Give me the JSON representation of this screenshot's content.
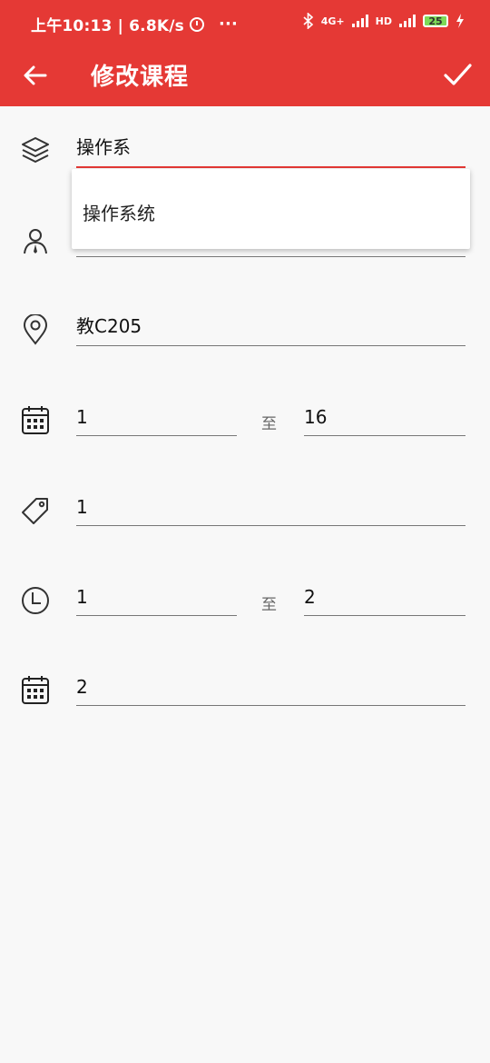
{
  "status_bar": {
    "time_speed": "上午10:13 | 6.8K/s",
    "more": "···",
    "network": "4G+",
    "hd": "HD",
    "battery": "25"
  },
  "app_bar": {
    "title": "修改课程"
  },
  "form": {
    "course_name": "操作系",
    "location": "教C205",
    "weeks_start": "1",
    "weeks_end": "16",
    "range_sep": "至",
    "tag": "1",
    "period_start": "1",
    "period_end": "2",
    "weekday": "2"
  },
  "autocomplete": {
    "items": [
      "操作系统"
    ]
  },
  "colors": {
    "primary": "#e53935",
    "background": "#f8f8f8"
  }
}
